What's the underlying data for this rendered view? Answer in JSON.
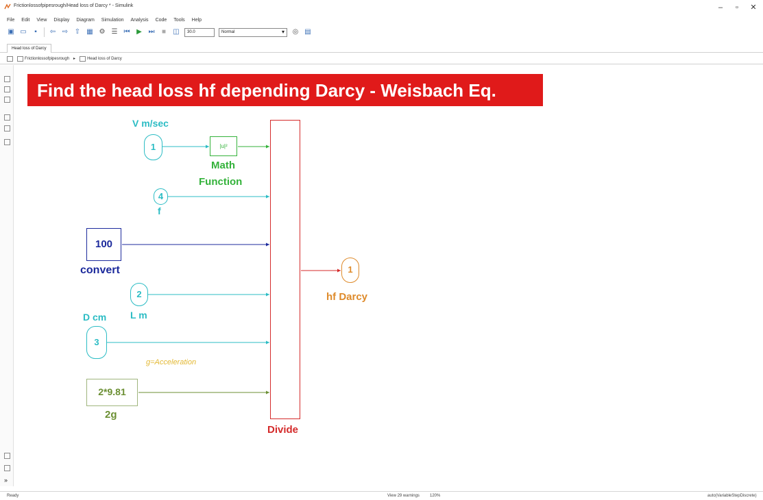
{
  "window": {
    "title": "Frictionlossofpipesrough/Head loss of Darcy * - Simulink",
    "minimize": "–",
    "maximize": "▫",
    "close": "✕"
  },
  "menu": [
    "File",
    "Edit",
    "View",
    "Display",
    "Diagram",
    "Simulation",
    "Analysis",
    "Code",
    "Tools",
    "Help"
  ],
  "toolbar": {
    "stop_time": "30.0",
    "sim_mode": "Normal"
  },
  "tab": "Head loss of Darcy",
  "breadcrumb": {
    "root": "Frictionlossofpipesrough",
    "sep": "▸",
    "current": "Head loss of Darcy"
  },
  "canvas": {
    "banner": "Find the head loss hf depending Darcy - Weisbach Eq.",
    "inport_v": {
      "number": "1",
      "label": "V m/sec"
    },
    "inport_f": {
      "number": "4",
      "label": "f"
    },
    "inport_l": {
      "number": "2",
      "label": "L m"
    },
    "inport_d": {
      "number": "3",
      "label": "D cm"
    },
    "math_function": {
      "glyph": "|u|²",
      "label_line1": "Math",
      "label_line2": "Function"
    },
    "constant_convert": {
      "value": "100",
      "label": "convert"
    },
    "constant_2g": {
      "value": "2*9.81",
      "label": "2g"
    },
    "annotation": "g=Acceleration",
    "divide": {
      "label": "Divide",
      "signs": [
        "×",
        "×",
        "×",
        "×",
        "÷",
        "÷"
      ]
    },
    "outport": {
      "number": "1",
      "label": "hf Darcy"
    }
  },
  "statusbar": {
    "left": "Ready",
    "center": "View 29 warnings",
    "zoom": "120%",
    "right": "auto(VariableStepDiscrete)"
  },
  "colors": {
    "banner": "#e01a1a",
    "inport": "#2bbcc4",
    "math": "#33b23a",
    "constant": "#1c2a9c",
    "outport": "#de8a2a",
    "divide": "#d42a2a"
  }
}
